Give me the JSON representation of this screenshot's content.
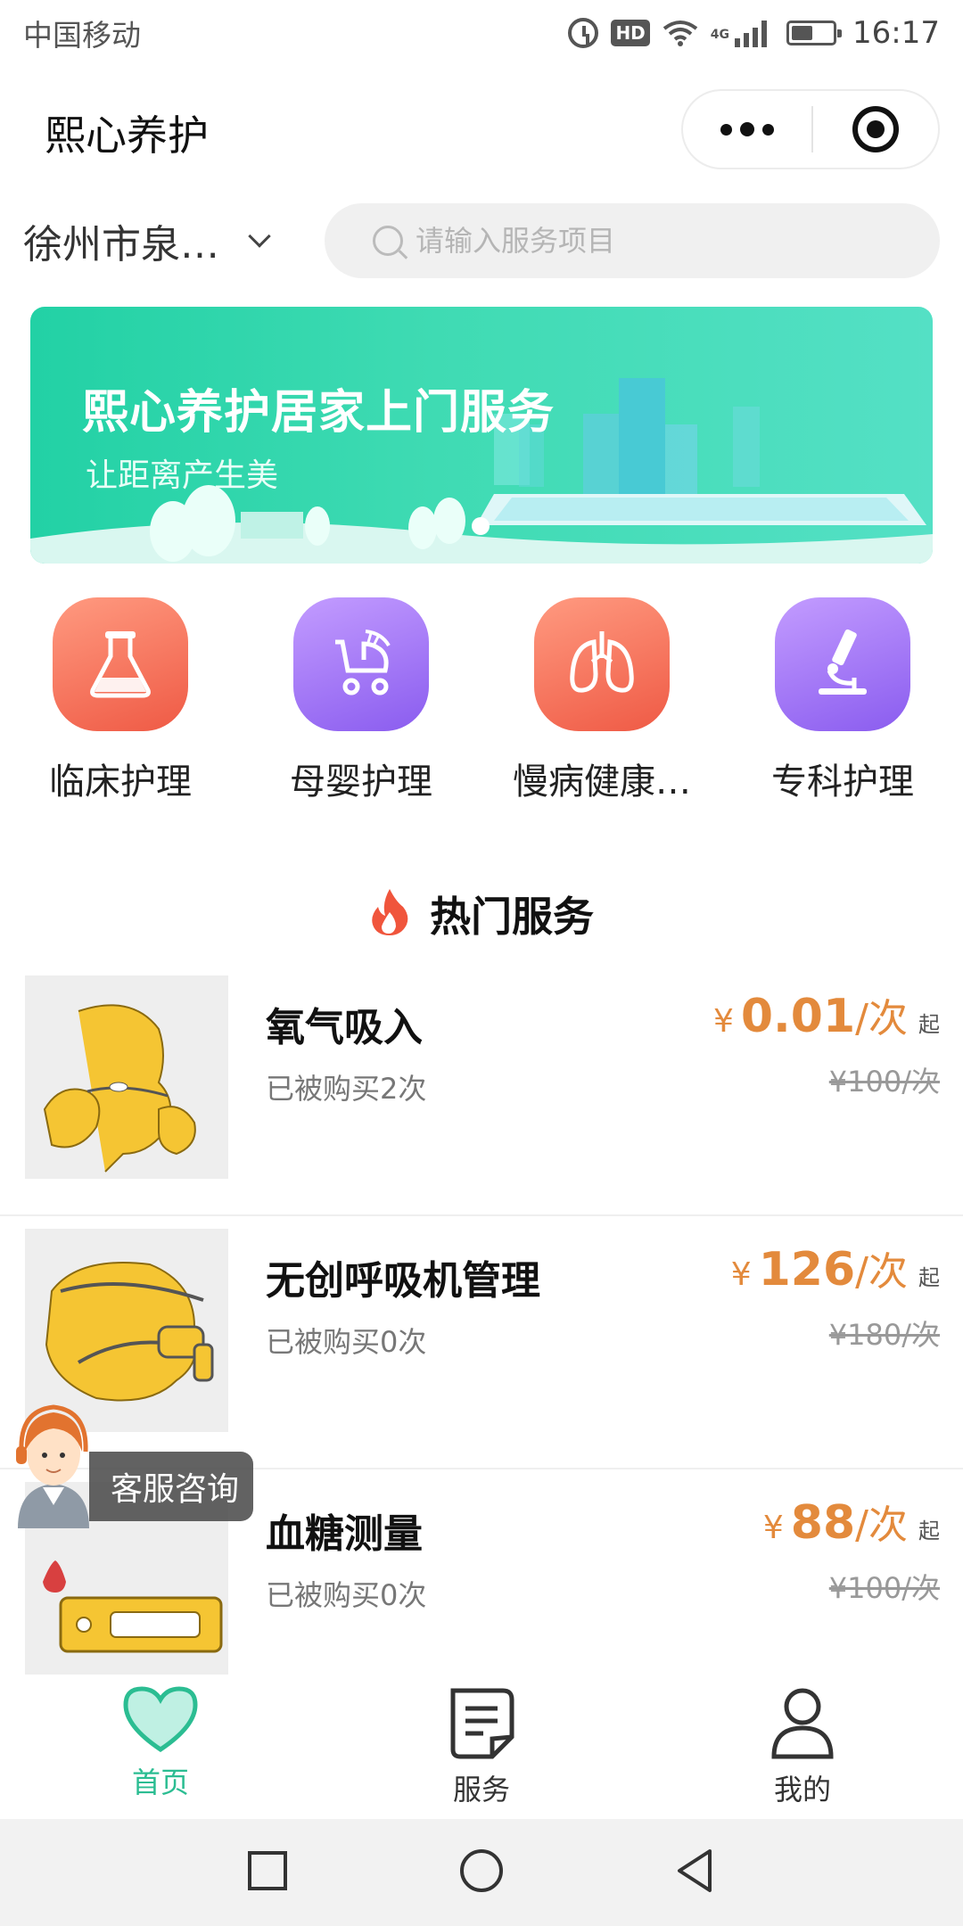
{
  "status_bar": {
    "carrier": "中国移动",
    "network": "4G",
    "time": "16:17",
    "hd_label": "HD",
    "battery_level": 0.52
  },
  "title_bar": {
    "app_title": "熙心养护"
  },
  "location": {
    "city_label": "徐州市泉…",
    "search_placeholder": "请输入服务项目"
  },
  "banner": {
    "title": "熙心养护居家上门服务",
    "subtitle": "让距离产生美",
    "colors": {
      "from": "#22d1a5",
      "to": "#54e0c5"
    }
  },
  "categories": [
    {
      "label": "临床护理",
      "icon": "flask-icon",
      "color": "#f26b57"
    },
    {
      "label": "母婴护理",
      "icon": "stroller-icon",
      "color": "#9b6cf0"
    },
    {
      "label": "慢病健康…",
      "icon": "lungs-icon",
      "color": "#f26b57"
    },
    {
      "label": "专科护理",
      "icon": "microscope-icon",
      "color": "#9b6cf0"
    }
  ],
  "hot": {
    "title": "热门服务",
    "icon": "flame-icon"
  },
  "items": [
    {
      "name": "氧气吸入",
      "sold": "已被购买2次",
      "yen": "¥",
      "price": "0.01",
      "unit": "/次",
      "qi": "起",
      "orig": "¥100/次"
    },
    {
      "name": "无创呼吸机管理",
      "sold": "已被购买0次",
      "yen": "¥",
      "price": "126",
      "unit": "/次",
      "qi": "起",
      "orig": "¥180/次"
    },
    {
      "name": "血糖测量",
      "sold": "已被购买0次",
      "yen": "¥",
      "price": "88",
      "unit": "/次",
      "qi": "起",
      "orig": "¥100/次"
    }
  ],
  "customer_service": {
    "label": "客服咨询"
  },
  "tabbar": {
    "home": "首页",
    "service": "服务",
    "mine": "我的",
    "active_color": "#2bbd92"
  },
  "colors": {
    "accent": "#2bbd92",
    "price": "#e38a3c"
  }
}
